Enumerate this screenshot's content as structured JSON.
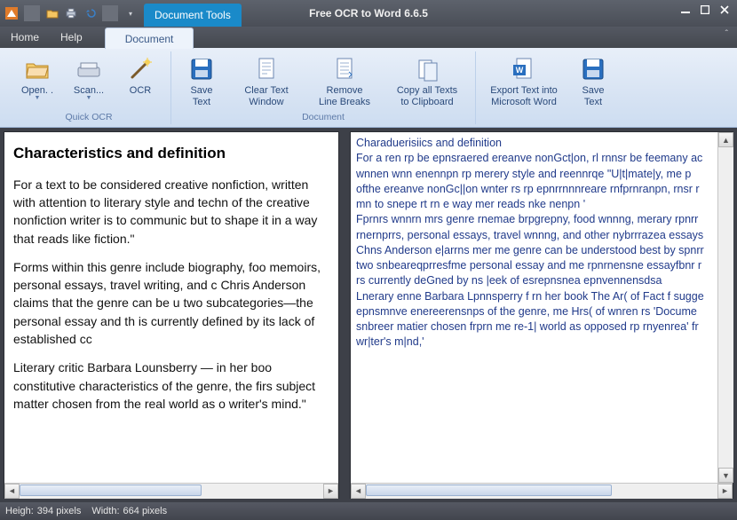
{
  "window": {
    "title": "Free OCR to Word 6.6.5",
    "tools_tab": "Document Tools"
  },
  "menu": {
    "home": "Home",
    "help": "Help",
    "document": "Document"
  },
  "ribbon": {
    "group_quick_ocr": "Quick OCR",
    "open": "Open. .",
    "scan": "Scan...",
    "ocr": "OCR",
    "save_text": "Save\nText",
    "clear_text_window": "Clear Text\nWindow",
    "remove_line_breaks": "Remove\nLine Breaks",
    "copy_all": "Copy all Texts\nto Clipboard",
    "export_word": "Export Text into\nMicrosoft Word",
    "save_text_2": "Save\nText"
  },
  "left": {
    "heading": "Characteristics and definition",
    "p1": "For a text to be considered creative nonfiction, written with attention to literary style and techn of the creative nonfiction writer is to communic but to shape it in a way that reads like fiction.\"",
    "p2": "Forms within this genre include biography, foo memoirs, personal essays, travel writing, and c Chris Anderson claims that the genre can be u two subcategories—the personal essay and th is currently defined by its lack of established cc",
    "p3": "Literary critic Barbara Lounsberry — in her boo constitutive characteristics of the genre, the firs subject matter chosen from the real world as o writer's mind.\""
  },
  "right": {
    "l0": "Charaduerisiics and definition",
    "l1": "For a ren rp be epnsraered ereanve nonGct|on, rl rnnsr be feemany ac",
    "l2": "wnnen wnn enennpn rp merery style and reennrqe \"U|t|mate|y, me p",
    "l3": "ofthe ereanve nonGc||on wnter rs rp epnrrnnnreare rnfprnranpn, rnsr r",
    "l4": "mn to snepe rt rn e way mer reads nke nenpn '",
    "l5": "Fprnrs wnnrn mrs genre rnemae brpgrepny, food wnnng, merary rpnrr",
    "l6": "rnernprrs, personal essays, travel wnnng, and other nybrrrazea essays",
    "l7": "Chns Anderson e|arrns mer me genre can be understood best by spnrr",
    "l8": "two snbeareqprresfme personal essay and me rpnrnensne essayfbnr r",
    "l9": "rs currently deGned by ns |eek of esrepnsnea epnvennensdsa",
    "l10": "Lnerary enne Barbara Lpnnsperry f rn her book The Ar( of Fact f sugge",
    "l11": "epnsmnve enereerensnps of the genre, me Hrs( of wnren rs 'Docume",
    "l12": "snbreer matier chosen frprn me re-1| world as opposed rp rnyenrea' fr",
    "l13": "wr|ter's m|nd,'"
  },
  "status": {
    "height_label": "Heigh:",
    "height_value": "394 pixels",
    "width_label": "Width:",
    "width_value": "664 pixels"
  },
  "icons": {
    "app": "app-icon",
    "open": "folder-open-icon",
    "print": "printer-icon",
    "undo": "undo-icon",
    "min": "minimize-icon",
    "max": "maximize-icon",
    "close": "close-icon"
  }
}
